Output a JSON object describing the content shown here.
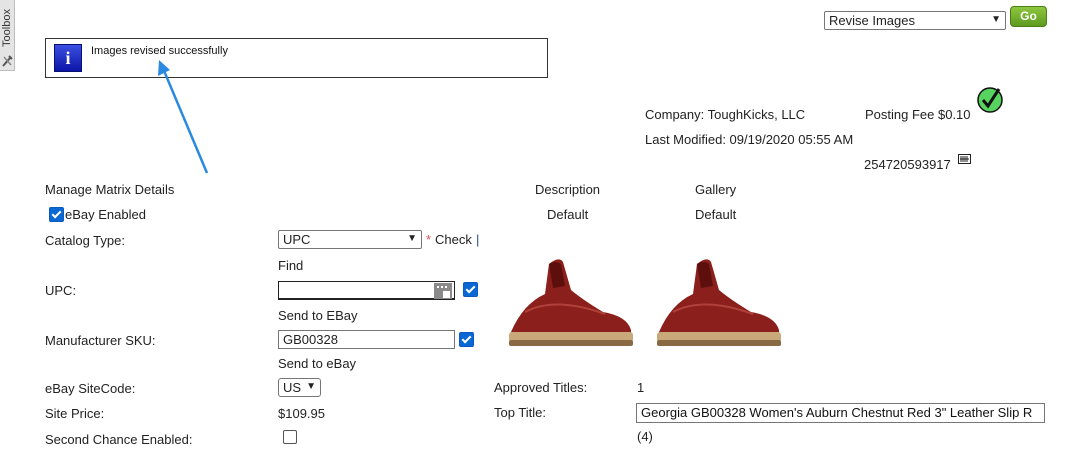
{
  "toolbox": {
    "label": "Toolbox"
  },
  "header": {
    "action_select": {
      "value": "Revise Images",
      "options": [
        "Revise Images"
      ]
    },
    "go_label": "Go"
  },
  "message": {
    "text": "Images revised successfully"
  },
  "listing": {
    "company": "Company: ToughKicks, LLC",
    "posting_fee": "Posting Fee $0.10",
    "last_modified": "Last Modified: 09/19/2020 05:55 AM",
    "item_id": "254720593917"
  },
  "form": {
    "manage_link": "Manage Matrix Details",
    "ebay_enabled_label": "eBay Enabled",
    "catalog_type_label": "Catalog Type:",
    "catalog_type_value": "UPC",
    "required_star": "*",
    "check_link": "Check",
    "separator": "|",
    "find_link": "Find",
    "upc_label": "UPC:",
    "upc_value": "",
    "send_to_ebay_1": "Send to EBay",
    "manufacturer_sku_label": "Manufacturer SKU:",
    "manufacturer_sku_value": "GB00328",
    "send_to_ebay_2": "Send to eBay",
    "site_code_label": "eBay SiteCode:",
    "site_code_value": "US",
    "site_price_label": "Site Price:",
    "site_price_value": "$109.95",
    "second_chance_label": "Second Chance Enabled:"
  },
  "images": {
    "description_header": "Description",
    "gallery_header": "Gallery",
    "description_value": "Default",
    "gallery_value": "Default"
  },
  "titles": {
    "approved_label": "Approved Titles:",
    "approved_count": "1",
    "top_title_label": "Top Title:",
    "top_title_value": "Georgia GB00328 Women's Auburn Chestnut Red 3\" Leather Slip R",
    "count": "(4)"
  },
  "colors": {
    "link": "#1f4e8c",
    "go_button": "#6fae2a",
    "info_icon": "#1a2bd0",
    "annotation_arrow": "#2a8ae0",
    "checkbox": "#0a68d4"
  }
}
